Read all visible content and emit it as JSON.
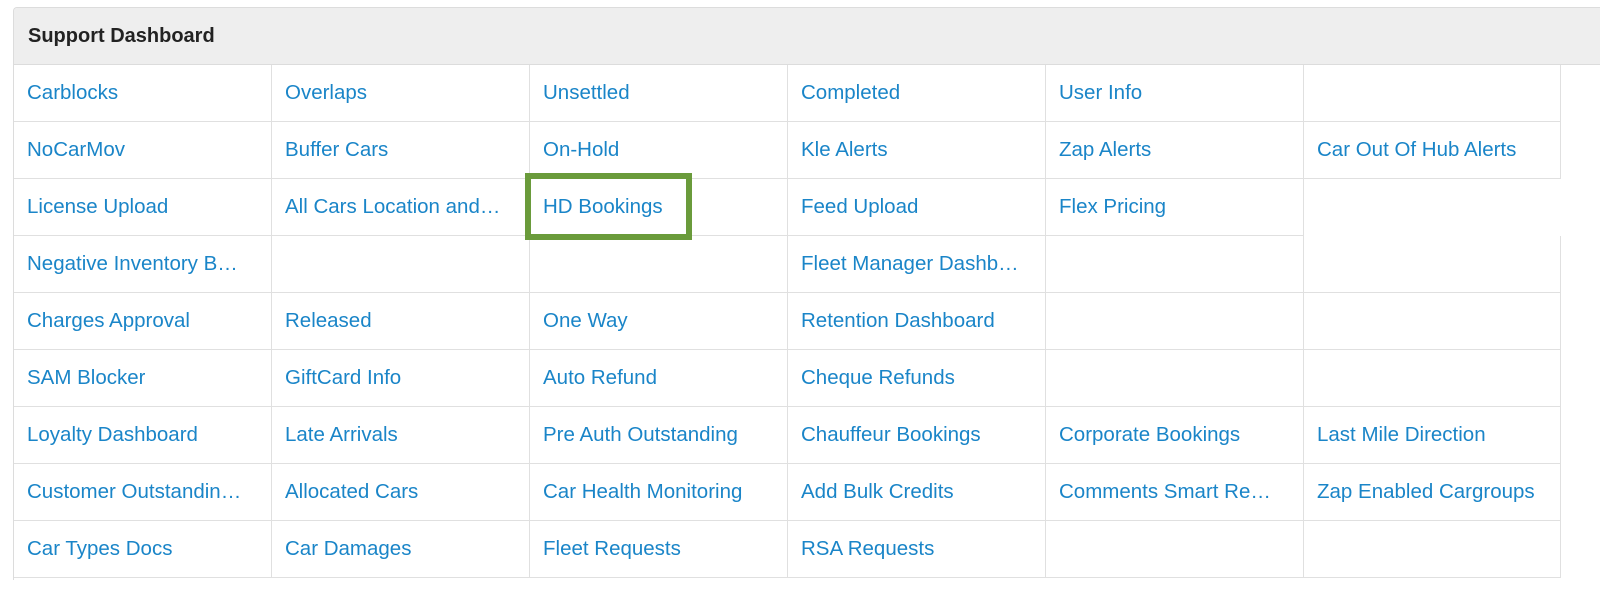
{
  "panel": {
    "title": "Support Dashboard"
  },
  "highlight_color": "#6a9b3b",
  "link_color": "#1a85c8",
  "rows": [
    [
      "Carblocks",
      "Overlaps",
      "Unsettled",
      "Completed",
      "User Info",
      ""
    ],
    [
      "NoCarMov",
      "Buffer Cars",
      "On-Hold",
      "Kle Alerts",
      "Zap Alerts",
      "Car Out Of Hub Alerts"
    ],
    [
      "License Upload",
      "All Cars Location and…",
      "HD Bookings",
      "Feed Upload",
      "Flex Pricing",
      ""
    ],
    [
      "Negative Inventory B…",
      "",
      "",
      "Fleet Manager Dashb…",
      "",
      ""
    ],
    [
      "Charges Approval",
      "Released",
      "One Way",
      "Retention Dashboard",
      "",
      ""
    ],
    [
      "SAM Blocker",
      "GiftCard Info",
      "Auto Refund",
      "Cheque Refunds",
      "",
      ""
    ],
    [
      "Loyalty Dashboard",
      "Late Arrivals",
      "Pre Auth Outstanding",
      "Chauffeur Bookings",
      "Corporate Bookings",
      "Last Mile Direction"
    ],
    [
      "Customer Outstandin…",
      "Allocated Cars",
      "Car Health Monitoring",
      "Add Bulk Credits",
      "Comments Smart Re…",
      "Zap Enabled Cargroups"
    ],
    [
      "Car Types Docs",
      "Car Damages",
      "Fleet Requests",
      "RSA Requests",
      "",
      ""
    ]
  ]
}
